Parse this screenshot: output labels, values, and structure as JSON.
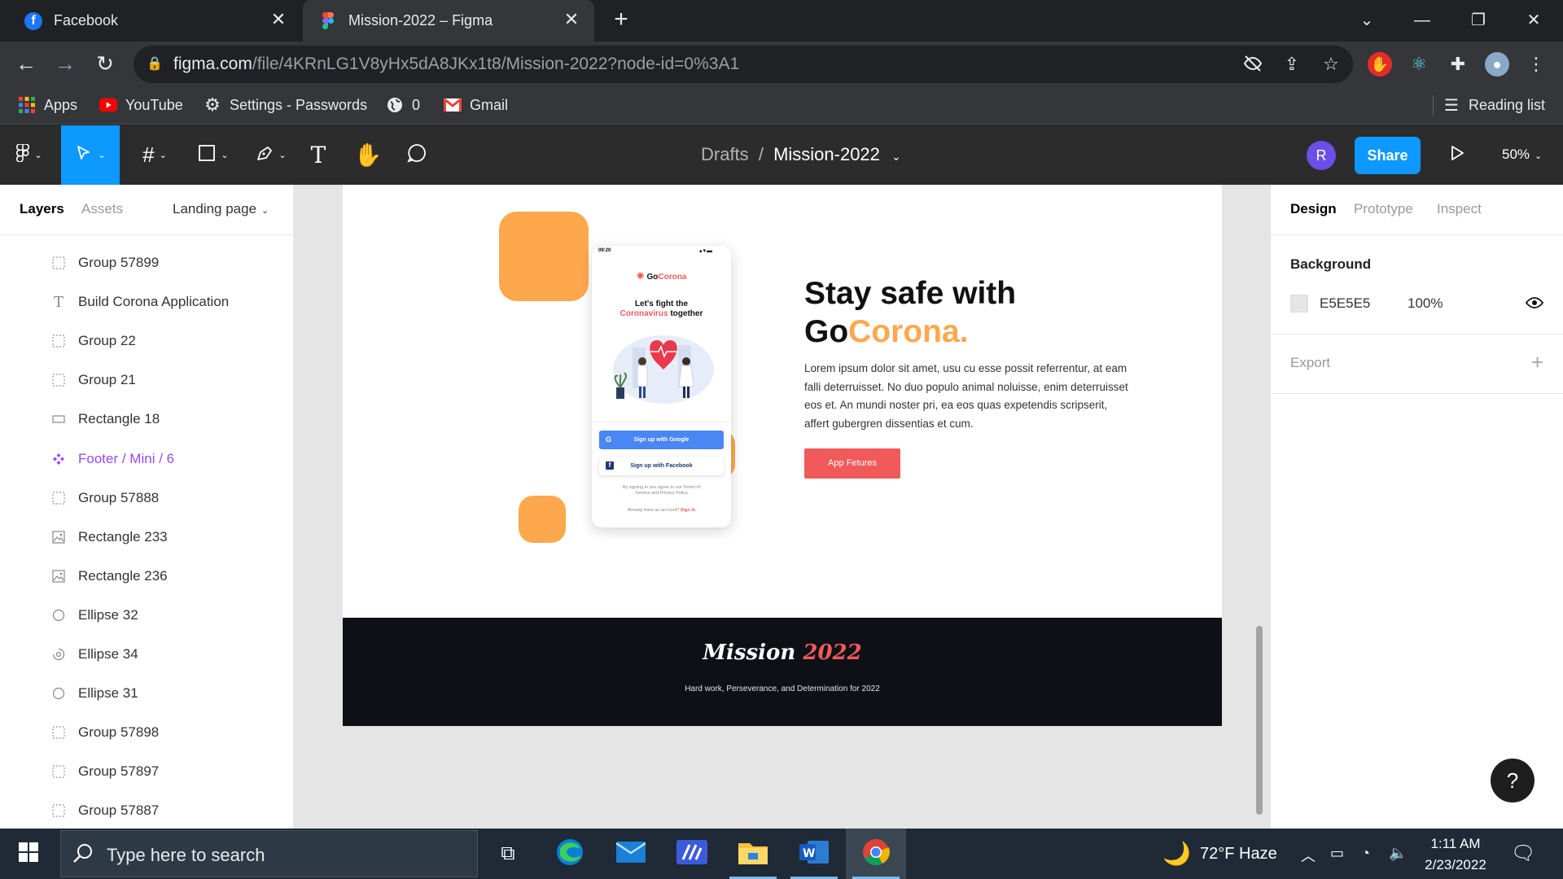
{
  "browser": {
    "tabs": [
      {
        "title": "Facebook",
        "icon": "facebook-icon"
      },
      {
        "title": "Mission-2022 – Figma",
        "icon": "figma-icon",
        "active": true
      }
    ],
    "url_host": "figma.com",
    "url_path": "/file/4KRnLG1V8yHx5dA8JKx1t8/Mission-2022?node-id=0%3A1",
    "bookmarks": [
      {
        "label": "Apps",
        "icon": "apps-grid-icon"
      },
      {
        "label": "YouTube",
        "icon": "youtube-icon"
      },
      {
        "label": "Settings - Passwords",
        "icon": "gear-icon"
      },
      {
        "label": "0",
        "icon": "globe-icon"
      },
      {
        "label": "Gmail",
        "icon": "gmail-icon"
      }
    ],
    "reading_list": "Reading list"
  },
  "figma": {
    "breadcrumb_parent": "Drafts",
    "breadcrumb_sep": "/",
    "file_name": "Mission-2022",
    "user_initial": "R",
    "share_label": "Share",
    "zoom": "50%"
  },
  "left_panel": {
    "tabs": [
      "Layers",
      "Assets"
    ],
    "page": "Landing page",
    "layers": [
      {
        "name": "Group 57899",
        "type": "group"
      },
      {
        "name": "Build Corona Application",
        "type": "text"
      },
      {
        "name": "Group 22",
        "type": "group"
      },
      {
        "name": "Group 21",
        "type": "group"
      },
      {
        "name": "Rectangle 18",
        "type": "rectangle"
      },
      {
        "name": "Footer / Mini / 6",
        "type": "component"
      },
      {
        "name": "Group 57888",
        "type": "group"
      },
      {
        "name": "Rectangle 233",
        "type": "image"
      },
      {
        "name": "Rectangle 236",
        "type": "image"
      },
      {
        "name": "Ellipse 32",
        "type": "ellipse"
      },
      {
        "name": "Ellipse 34",
        "type": "ellipse-arc"
      },
      {
        "name": "Ellipse 31",
        "type": "ellipse"
      },
      {
        "name": "Group 57898",
        "type": "group"
      },
      {
        "name": "Group 57897",
        "type": "group"
      },
      {
        "name": "Group 57887",
        "type": "group"
      }
    ]
  },
  "canvas": {
    "phone": {
      "time": "09:20",
      "brand_go": "Go",
      "brand_corona": "Corona",
      "headline_1": "Let's fight the",
      "headline_2a": "Coronavirus",
      "headline_2b": " together",
      "btn_google": "Sign up with Google",
      "btn_facebook": "Sign up with Facebook",
      "terms_1": "By signing in you agree to our Terms of",
      "terms_2": "Service and Privacy Policy",
      "signin_prefix": "Already have an account? ",
      "signin_link": "Sign In"
    },
    "hero": {
      "title_line1": "Stay safe with",
      "title_go": "Go",
      "title_corona": "Corona.",
      "body": "Lorem ipsum dolor sit amet, usu cu esse possit referrentur, at eam falli deterruisset. No duo populo animal noluisse, enim deterruisset eos et. An mundi noster pri, ea eos quas expetendis scripserit, affert gubergren dissentias et cum.",
      "cta": "App Fetures"
    },
    "footer": {
      "brand_mission": "Mission",
      "brand_year": "2022",
      "tagline": "Hard work, Perseverance, and Determination for 2022"
    }
  },
  "right_panel": {
    "tabs": [
      "Design",
      "Prototype",
      "Inspect"
    ],
    "background_label": "Background",
    "background_hex": "E5E5E5",
    "background_opacity": "100%",
    "export_label": "Export",
    "help": "?"
  },
  "taskbar": {
    "search_placeholder": "Type here to search",
    "weather": "72°F  Haze",
    "time": "1:11 AM",
    "date": "2/23/2022"
  },
  "colors": {
    "accent_orange": "#fea84e",
    "cta_red": "#f05a5a",
    "figma_blue": "#0d99ff",
    "footer_dark": "#0d1017",
    "canvas_bg": "#e5e5e5"
  }
}
